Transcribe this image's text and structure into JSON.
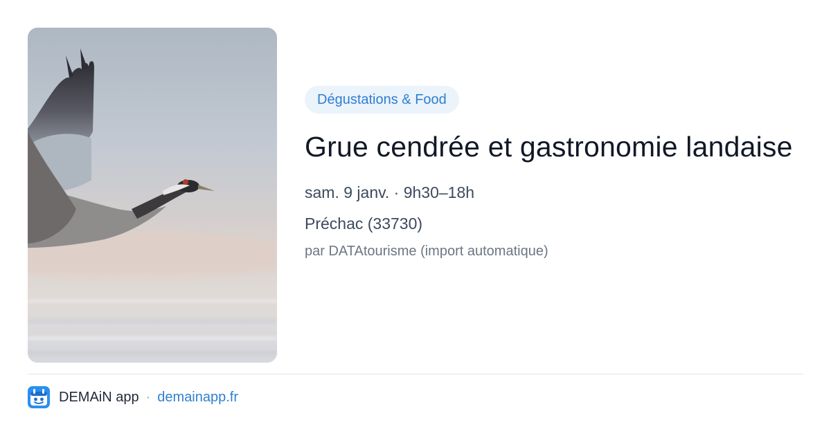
{
  "event": {
    "category": "Dégustations & Food",
    "title": "Grue cendrée et gastronomie landaise",
    "date_time": "sam. 9 janv. · 9h30–18h",
    "location": "Préchac (33730)",
    "source": "par DATAtourisme (import automatique)",
    "image": "crane-in-flight-photo"
  },
  "footer": {
    "app_name": "DEMAiN app",
    "separator": "·",
    "url": "demainapp.fr",
    "logo_icon": "demain-logo-icon"
  },
  "colors": {
    "accent": "#2f7fd0",
    "tag_background": "#ebf3fb",
    "title": "#111827",
    "meta": "#3d4a5c",
    "divider": "#dde3ea"
  }
}
